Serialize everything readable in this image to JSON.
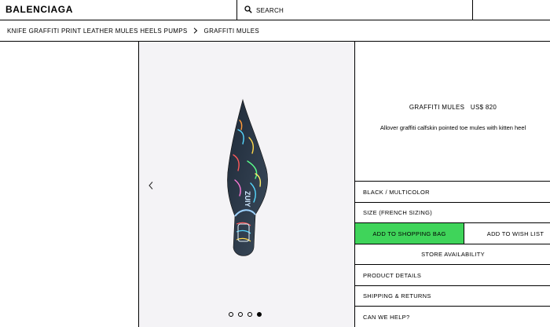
{
  "header": {
    "logo": "BALENCIAGA",
    "search_label": "SEARCH"
  },
  "breadcrumb": {
    "items": [
      "KNIFE GRAFFITI PRINT LEATHER MULES HEELS PUMPS",
      "GRAFFITI MULES"
    ]
  },
  "product": {
    "name": "GRAFFITI MULES",
    "price": "US$ 820",
    "description": "Allover graffiti calfskin pointed toe mules with kitten heel",
    "color": "BLACK / MULTICOLOR",
    "size_label": "SIZE (FRENCH SIZING)",
    "add_to_bag": "ADD TO SHOPPING BAG",
    "add_to_wishlist": "ADD TO WISH LIST",
    "store_availability": "STORE AVAILABILITY",
    "details": "PRODUCT DETAILS",
    "shipping": "SHIPPING & RETURNS",
    "help": "CAN WE HELP?"
  },
  "gallery": {
    "slide_count": 4,
    "active_slide": 4
  },
  "colors": {
    "accent_green": "#3fd45a",
    "image_bg": "#f4f3f6"
  },
  "icons": [
    "search-icon",
    "chevron-right-icon",
    "chevron-left-icon"
  ]
}
